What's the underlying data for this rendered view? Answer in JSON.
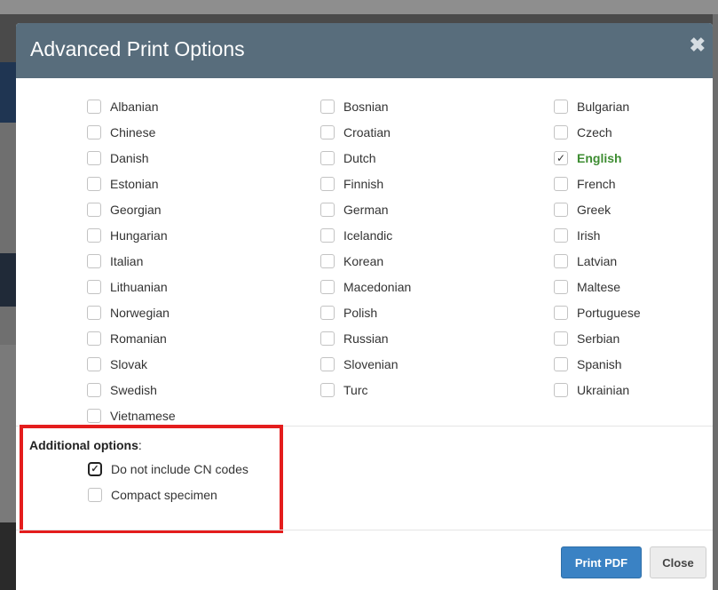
{
  "dialog": {
    "title": "Advanced Print Options",
    "close_icon": "times-icon"
  },
  "languages": {
    "columns": [
      [
        {
          "label": "Albanian",
          "checked": false
        },
        {
          "label": "Chinese",
          "checked": false
        },
        {
          "label": "Danish",
          "checked": false
        },
        {
          "label": "Estonian",
          "checked": false
        },
        {
          "label": "Georgian",
          "checked": false
        },
        {
          "label": "Hungarian",
          "checked": false
        },
        {
          "label": "Italian",
          "checked": false
        },
        {
          "label": "Lithuanian",
          "checked": false
        },
        {
          "label": "Norwegian",
          "checked": false
        },
        {
          "label": "Romanian",
          "checked": false
        },
        {
          "label": "Slovak",
          "checked": false
        },
        {
          "label": "Swedish",
          "checked": false
        },
        {
          "label": "Vietnamese",
          "checked": false
        }
      ],
      [
        {
          "label": "Bosnian",
          "checked": false
        },
        {
          "label": "Croatian",
          "checked": false
        },
        {
          "label": "Dutch",
          "checked": false
        },
        {
          "label": "Finnish",
          "checked": false
        },
        {
          "label": "German",
          "checked": false
        },
        {
          "label": "Icelandic",
          "checked": false
        },
        {
          "label": "Korean",
          "checked": false
        },
        {
          "label": "Macedonian",
          "checked": false
        },
        {
          "label": "Polish",
          "checked": false
        },
        {
          "label": "Russian",
          "checked": false
        },
        {
          "label": "Slovenian",
          "checked": false
        },
        {
          "label": "Turc",
          "checked": false
        }
      ],
      [
        {
          "label": "Bulgarian",
          "checked": false
        },
        {
          "label": "Czech",
          "checked": false
        },
        {
          "label": "English",
          "checked": true
        },
        {
          "label": "French",
          "checked": false
        },
        {
          "label": "Greek",
          "checked": false
        },
        {
          "label": "Irish",
          "checked": false
        },
        {
          "label": "Latvian",
          "checked": false
        },
        {
          "label": "Maltese",
          "checked": false
        },
        {
          "label": "Portuguese",
          "checked": false
        },
        {
          "label": "Serbian",
          "checked": false
        },
        {
          "label": "Spanish",
          "checked": false
        },
        {
          "label": "Ukrainian",
          "checked": false
        }
      ]
    ]
  },
  "additional_options": {
    "label": "Additional options",
    "colon": ":",
    "items": [
      {
        "label": "Do not include CN codes",
        "checked": true
      },
      {
        "label": "Compact specimen",
        "checked": false
      }
    ]
  },
  "footer": {
    "print_label": "Print PDF",
    "close_label": "Close"
  },
  "colors": {
    "header_bg": "#586d7c",
    "checked_text": "#3e8d32",
    "highlight_border": "#e41d1d",
    "primary_button": "#3a82c4"
  }
}
